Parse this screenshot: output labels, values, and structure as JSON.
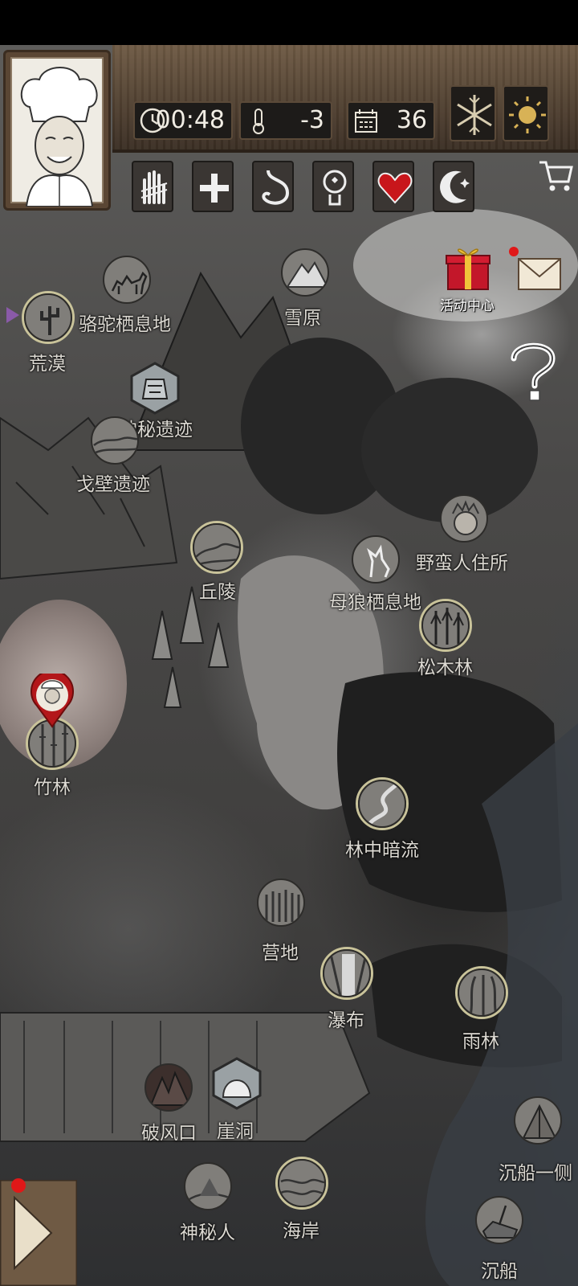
{
  "status": {
    "time": "00:48",
    "temperature": "-3",
    "day": "36"
  },
  "activity_center": {
    "label": "活动中心"
  },
  "map": {
    "current_location": "竹林",
    "locations": [
      {
        "id": "camel",
        "label": "骆驼栖息地"
      },
      {
        "id": "desert",
        "label": "荒漠"
      },
      {
        "id": "snowfield",
        "label": "雪原"
      },
      {
        "id": "mystery_ruins",
        "label": "神秘遗迹"
      },
      {
        "id": "gobi_ruins",
        "label": "戈壁遗迹"
      },
      {
        "id": "hills",
        "label": "丘陵"
      },
      {
        "id": "savage_home",
        "label": "野蛮人住所"
      },
      {
        "id": "wolf_den",
        "label": "母狼栖息地"
      },
      {
        "id": "pine_forest",
        "label": "松木林"
      },
      {
        "id": "bamboo",
        "label": "竹林"
      },
      {
        "id": "forest_stream",
        "label": "林中暗流"
      },
      {
        "id": "camp",
        "label": "营地"
      },
      {
        "id": "waterfall",
        "label": "瀑布"
      },
      {
        "id": "rainforest",
        "label": "雨林"
      },
      {
        "id": "wind_gap",
        "label": "破风口"
      },
      {
        "id": "cliff_cave",
        "label": "崖洞"
      },
      {
        "id": "shipwreck_side",
        "label": "沉船一侧"
      },
      {
        "id": "mystery_person",
        "label": "神秘人"
      },
      {
        "id": "coast",
        "label": "海岸"
      },
      {
        "id": "shipwreck",
        "label": "沉船"
      }
    ]
  },
  "colors": {
    "heart": "#c8161b",
    "notification": "#e01818",
    "wood": "#5a4634"
  },
  "icons": {
    "weather_left": "snowflake-icon",
    "weather_right": "sun-icon"
  }
}
